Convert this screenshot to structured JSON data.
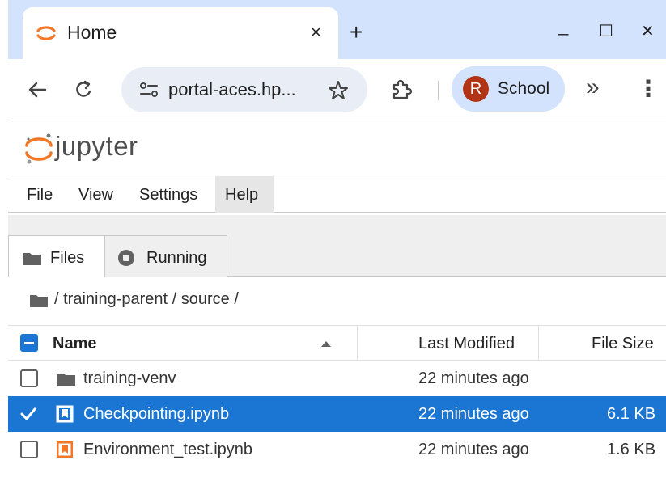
{
  "browser": {
    "tab_title": "Home",
    "tab_close": "×",
    "new_tab": "+",
    "window_controls": {
      "minimize": "_",
      "maximize": "☐",
      "close": "✕"
    },
    "url": "portal-aces.hp...",
    "profile_initial": "R",
    "profile_name": "School",
    "overflow": "»",
    "menu": "⋮",
    "colors": {
      "tabstrip": "#d3e3fd",
      "omnibox": "#e9eef6",
      "avatar": "#b23416"
    }
  },
  "jupyter": {
    "wordmark": "jupyter",
    "menus": [
      "File",
      "View",
      "Settings",
      "Help"
    ],
    "active_menu": "Help",
    "side_tabs": [
      {
        "label": "Files",
        "icon": "folder-icon",
        "active": true
      },
      {
        "label": "Running",
        "icon": "stop-circle-icon",
        "active": false
      }
    ],
    "breadcrumb": "/ training-parent / source /",
    "columns": {
      "name": "Name",
      "modified": "Last Modified",
      "size": "File Size"
    },
    "files": [
      {
        "name": "training-venv",
        "type": "folder-icon",
        "modified": "22 minutes ago",
        "size": "",
        "selected": false
      },
      {
        "name": "Checkpointing.ipynb",
        "type": "notebook-icon",
        "modified": "22 minutes ago",
        "size": "6.1 KB",
        "selected": true
      },
      {
        "name": "Environment_test.ipynb",
        "type": "notebook-icon",
        "modified": "22 minutes ago",
        "size": "1.6 KB",
        "selected": false
      }
    ],
    "colors": {
      "selection": "#1a76d2",
      "notebook": "#f37726"
    }
  }
}
